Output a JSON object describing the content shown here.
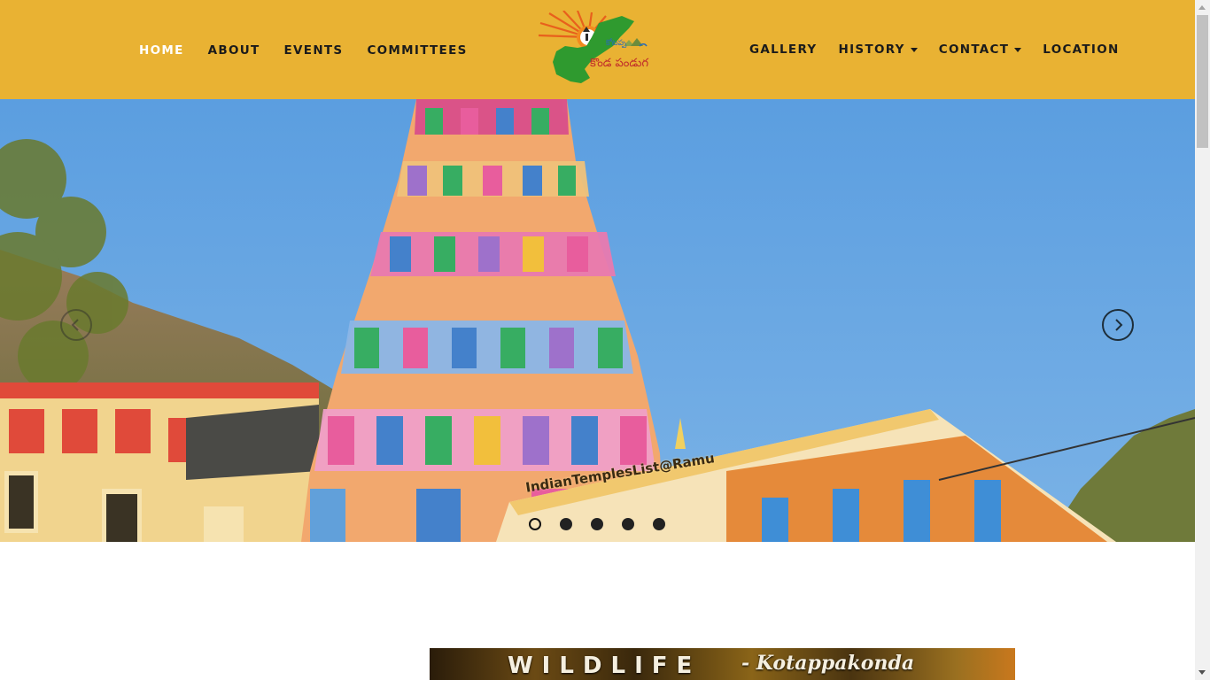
{
  "nav": {
    "left": [
      {
        "label": "HOME",
        "active": true
      },
      {
        "label": "ABOUT"
      },
      {
        "label": "EVENTS"
      },
      {
        "label": "COMMITTEES"
      }
    ],
    "right": [
      {
        "label": "GALLERY"
      },
      {
        "label": "HISTORY",
        "dropdown": true
      },
      {
        "label": "CONTACT",
        "dropdown": true
      },
      {
        "label": "LOCATION"
      }
    ]
  },
  "logo": {
    "text": "కొండ పండుగ"
  },
  "hero": {
    "watermark": "IndianTemplesList@Ramu",
    "slide_count": 5,
    "active_slide": 1
  },
  "banner": {
    "title": "WILDLIFE",
    "subtitle": "- Kotappakonda"
  },
  "colors": {
    "header": "#e9b233",
    "active_nav": "#ffffff",
    "nav_text": "#1b1b1b"
  }
}
